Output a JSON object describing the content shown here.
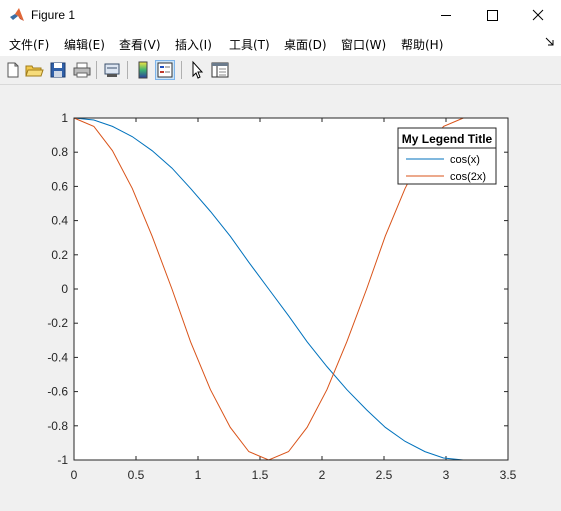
{
  "window": {
    "title": "Figure 1"
  },
  "menu": {
    "items": [
      "文件(F)",
      "编辑(E)",
      "查看(V)",
      "插入(I)",
      "工具(T)",
      "桌面(D)",
      "窗口(W)",
      "帮助(H)"
    ]
  },
  "toolbar": {
    "buttons": [
      "new-figure-icon",
      "open-file-icon",
      "save-icon",
      "print-icon",
      "link-plot-icon",
      "colorbar-icon",
      "legend-icon",
      "pointer-icon",
      "property-inspector-icon"
    ]
  },
  "chart_data": {
    "type": "line",
    "title": "",
    "xlabel": "",
    "ylabel": "",
    "xlim": [
      0,
      3.5
    ],
    "ylim": [
      -1,
      1
    ],
    "xticks": [
      "0",
      "0.5",
      "1",
      "1.5",
      "2",
      "2.5",
      "3",
      "3.5"
    ],
    "yticks": [
      "-1",
      "-0.8",
      "-0.6",
      "-0.4",
      "-0.2",
      "0",
      "0.2",
      "0.4",
      "0.6",
      "0.8",
      "1"
    ],
    "grid": false,
    "legend": {
      "title": "My Legend Title",
      "position": "top-right"
    },
    "series": [
      {
        "name": "cos(x)",
        "color": "#0072bd",
        "x": [
          0,
          0.16,
          0.31,
          0.47,
          0.63,
          0.79,
          0.94,
          1.1,
          1.26,
          1.41,
          1.57,
          1.73,
          1.88,
          2.04,
          2.2,
          2.36,
          2.51,
          2.67,
          2.83,
          2.98,
          3.14
        ],
        "y": [
          1,
          0.988,
          0.951,
          0.891,
          0.809,
          0.707,
          0.588,
          0.454,
          0.309,
          0.156,
          0,
          -0.156,
          -0.309,
          -0.454,
          -0.588,
          -0.707,
          -0.809,
          -0.891,
          -0.951,
          -0.988,
          -1
        ]
      },
      {
        "name": "cos(2x)",
        "color": "#d95319",
        "x": [
          0,
          0.16,
          0.31,
          0.47,
          0.63,
          0.79,
          0.94,
          1.1,
          1.26,
          1.41,
          1.57,
          1.73,
          1.88,
          2.04,
          2.2,
          2.36,
          2.51,
          2.67,
          2.83,
          2.98,
          3.14
        ],
        "y": [
          1,
          0.951,
          0.809,
          0.588,
          0.309,
          0,
          -0.309,
          -0.588,
          -0.809,
          -0.951,
          -1,
          -0.951,
          -0.809,
          -0.588,
          -0.309,
          0,
          0.309,
          0.588,
          0.809,
          0.951,
          1
        ]
      }
    ]
  }
}
